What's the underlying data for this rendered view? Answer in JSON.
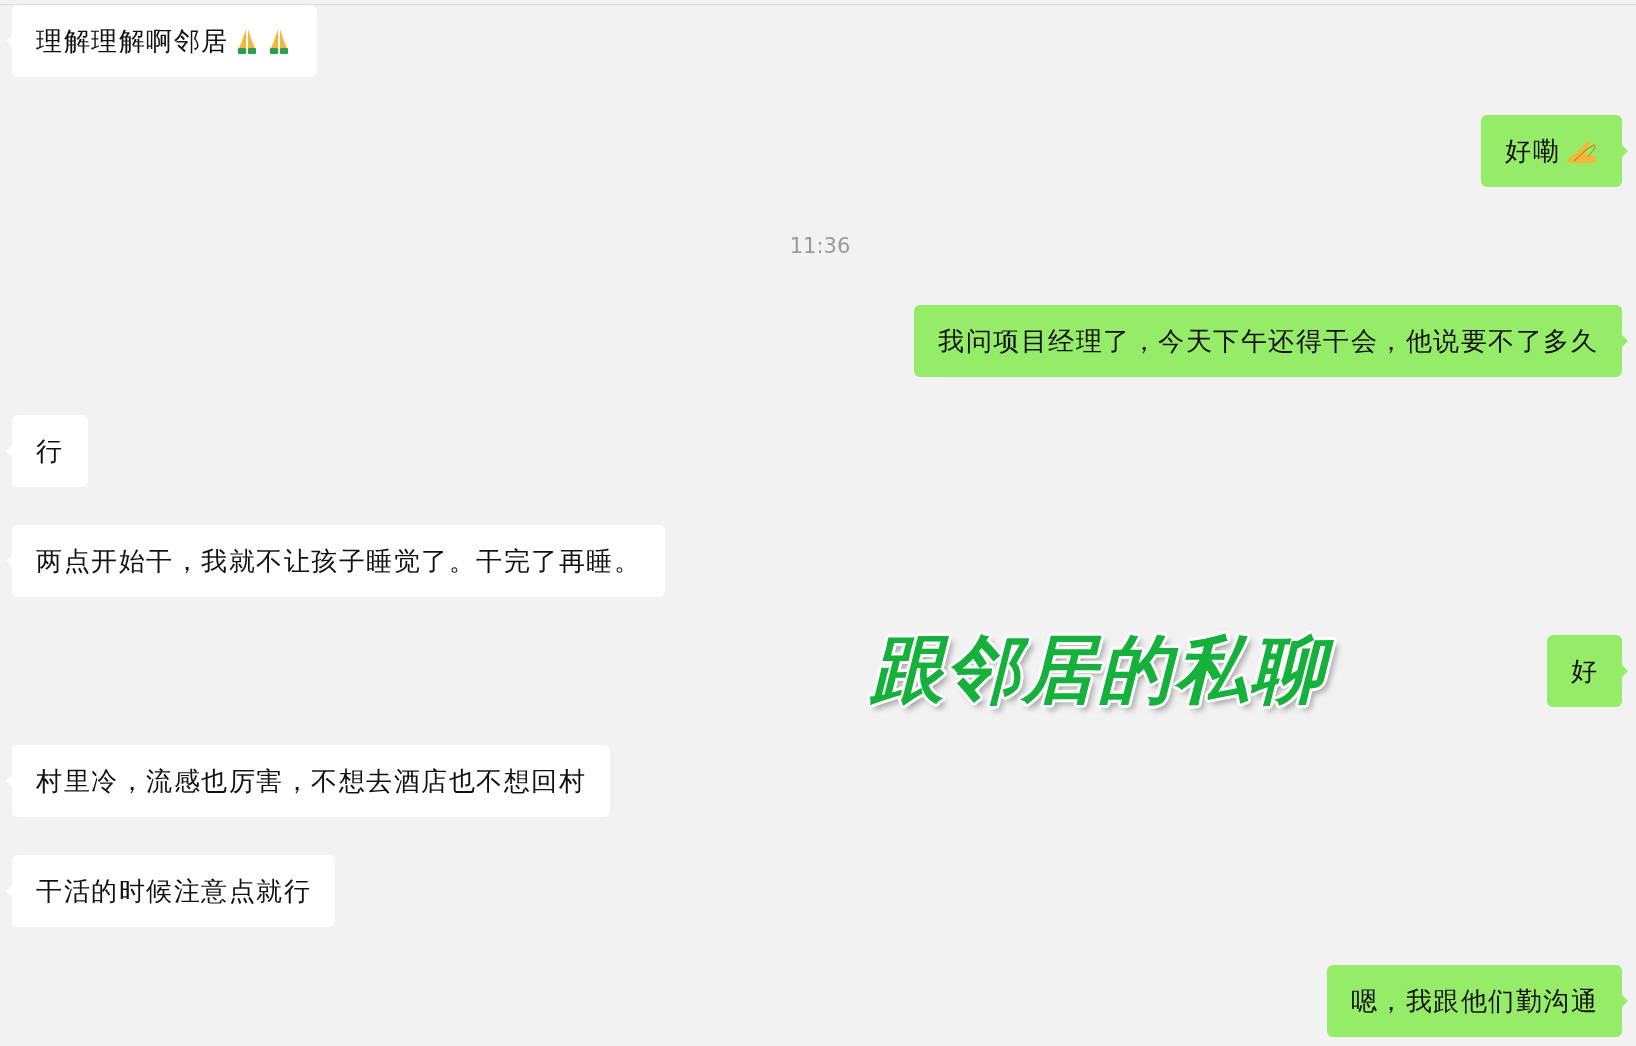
{
  "messages": [
    {
      "kind": "message",
      "sent": false,
      "text": "理解理解啊邻居",
      "icons": [
        {
          "kind": "praying-hands"
        },
        {
          "kind": "praying-hands"
        }
      ]
    },
    {
      "kind": "message",
      "sent": true,
      "text": "好嘞",
      "icons": [
        {
          "kind": "joined-palms"
        }
      ]
    },
    {
      "kind": "time",
      "text": "11:36"
    },
    {
      "kind": "message",
      "sent": true,
      "text": "我问项目经理了，今天下午还得干会，他说要不了多久"
    },
    {
      "kind": "message",
      "sent": false,
      "text": "行"
    },
    {
      "kind": "message",
      "sent": false,
      "text": "两点开始干，我就不让孩子睡觉了。干完了再睡。"
    },
    {
      "kind": "message",
      "sent": true,
      "text": "好"
    },
    {
      "kind": "message",
      "sent": false,
      "text": "村里冷，流感也厉害，不想去酒店也不想回村"
    },
    {
      "kind": "message",
      "sent": false,
      "text": "干活的时候注意点就行"
    },
    {
      "kind": "message",
      "sent": true,
      "text": "嗯，我跟他们勤沟通"
    }
  ],
  "caption": {
    "text": "跟邻居的私聊"
  }
}
